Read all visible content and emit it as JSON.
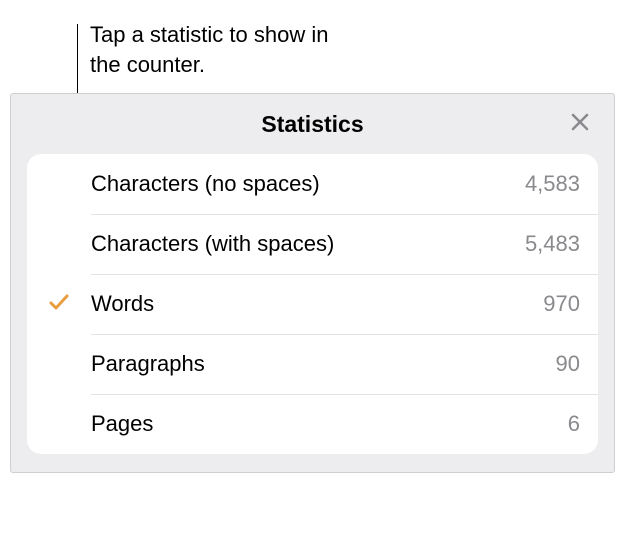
{
  "callout": "Tap a statistic to show in the counter.",
  "panel": {
    "title": "Statistics",
    "rows": [
      {
        "label": "Characters (no spaces)",
        "value": "4,583",
        "selected": false
      },
      {
        "label": "Characters (with spaces)",
        "value": "5,483",
        "selected": false
      },
      {
        "label": "Words",
        "value": "970",
        "selected": true
      },
      {
        "label": "Paragraphs",
        "value": "90",
        "selected": false
      },
      {
        "label": "Pages",
        "value": "6",
        "selected": false
      }
    ]
  }
}
